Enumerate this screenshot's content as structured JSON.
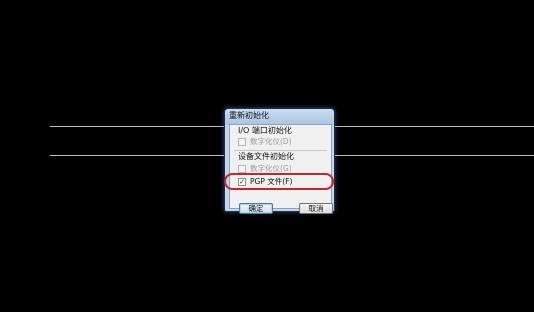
{
  "dialog": {
    "title": "重新初始化",
    "groups": [
      {
        "label": "I/O 端口初始化",
        "checkbox_label": "数字化仪(D)",
        "checked": false,
        "enabled": false
      },
      {
        "label": "设备文件初始化",
        "checkbox_label": "数字化仪(G)",
        "checked": false,
        "enabled": false
      }
    ],
    "pgp_checkbox": {
      "label": "PGP 文件(F)",
      "checked": true,
      "check_mark": "✓"
    },
    "buttons": {
      "ok_label": "确定",
      "cancel_label": "取消"
    },
    "highlight_color": "#c8242a",
    "background_color": "#000000"
  }
}
